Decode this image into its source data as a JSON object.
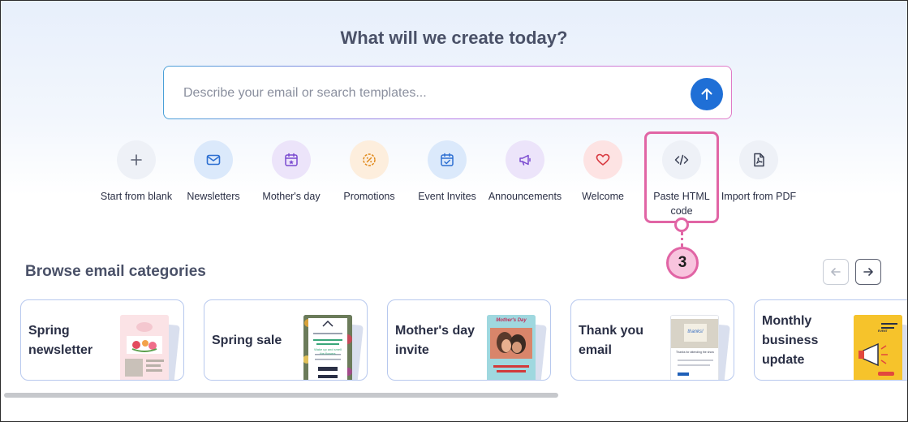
{
  "header": {
    "title": "What will we create today?"
  },
  "search": {
    "placeholder": "Describe your email or search templates..."
  },
  "quick_actions": [
    {
      "label": "Start from blank",
      "icon": "plus-icon",
      "bg": "#eef1f7",
      "fg": "#5a6072"
    },
    {
      "label": "Newsletters",
      "icon": "envelope-icon",
      "bg": "#dbe9fb",
      "fg": "#2d6fd1"
    },
    {
      "label": "Mother's day",
      "icon": "calendar-star-icon",
      "bg": "#ece4fa",
      "fg": "#7a4ad0"
    },
    {
      "label": "Promotions",
      "icon": "percent-badge-icon",
      "bg": "#fdeedd",
      "fg": "#e08a1c"
    },
    {
      "label": "Event Invites",
      "icon": "calendar-check-icon",
      "bg": "#dbe9fb",
      "fg": "#2d6fd1"
    },
    {
      "label": "Announcements",
      "icon": "megaphone-icon",
      "bg": "#ece4fa",
      "fg": "#7a4ad0"
    },
    {
      "label": "Welcome",
      "icon": "heart-icon",
      "bg": "#fde3e3",
      "fg": "#d8383f"
    },
    {
      "label": "Paste HTML code",
      "icon": "code-icon",
      "bg": "#eef1f7",
      "fg": "#3a4054"
    },
    {
      "label": "Import from PDF",
      "icon": "pdf-file-icon",
      "bg": "#eef1f7",
      "fg": "#3a4054"
    }
  ],
  "callout": {
    "step": "3",
    "color": "#e165a5"
  },
  "browse": {
    "title": "Browse email categories",
    "cards": [
      {
        "title": "Spring newsletter"
      },
      {
        "title": "Spring sale"
      },
      {
        "title": "Mother's day invite"
      },
      {
        "title": "Thank you email"
      },
      {
        "title": "Monthly business update"
      }
    ],
    "thumbs": {
      "mothers_day": "Mother's Day",
      "thank_you_note": "thanks!",
      "thank_you_text": "Thanks for attending the show",
      "spring_sale_text": "Wake up and smell the flowers",
      "monthly_text": "Event"
    }
  },
  "colors": {
    "accent": "#1f6fd6",
    "highlight": "#e165a5"
  }
}
